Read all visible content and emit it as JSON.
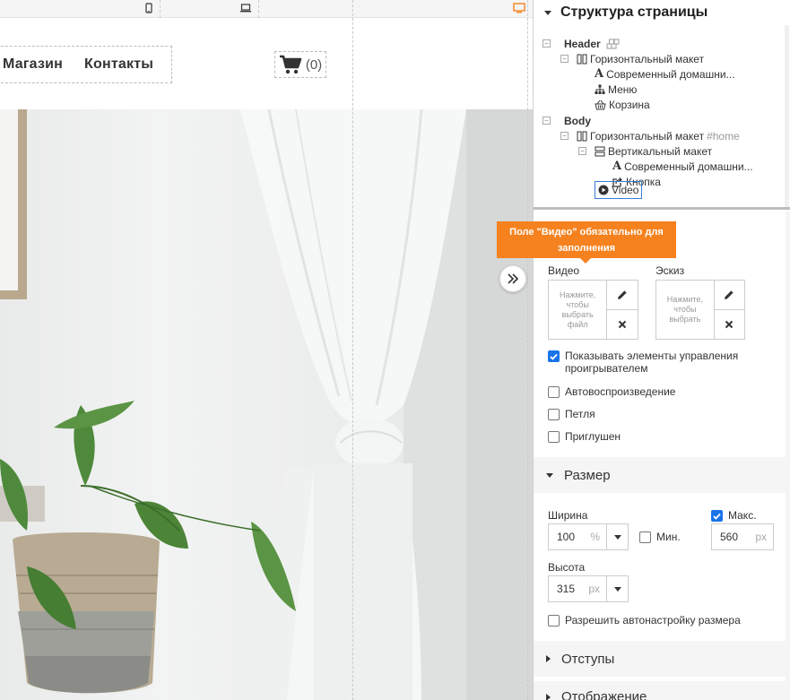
{
  "site": {
    "nav": [
      "Магазин",
      "Контакты"
    ],
    "cart_count": "(0)"
  },
  "tree": {
    "title": "Структура страницы",
    "header_label": "Header",
    "header_layout": "Горизонтальный макет",
    "header_text": "Современный домашни...",
    "header_menu": "Меню",
    "header_cart": "Корзина",
    "body_label": "Body",
    "body_layout": "Горизонтальный макет",
    "body_layout_id": "#home",
    "body_vlayout": "Вертикальный макет",
    "body_text": "Современный домашни...",
    "body_button": "Кнопка",
    "body_video": "Video"
  },
  "tooltip": {
    "line1": "Поле \"Видео\" обязательно для",
    "line2": "заполнения"
  },
  "video_settings": {
    "video_label": "Видео",
    "video_hint": "Нажмите, чтобы выбрать файл",
    "thumb_label": "Эскиз",
    "thumb_hint": "Нажмите, чтобы выбрать",
    "show_controls": "Показывать элементы управления проигрывателем",
    "autoplay": "Автовоспроизведение",
    "loop": "Петля",
    "muted": "Приглушен"
  },
  "size": {
    "section_title": "Размер",
    "width_label": "Ширина",
    "width_value": "100",
    "width_unit": "%",
    "min_label": "Мин.",
    "max_label": "Макс.",
    "max_value": "560",
    "max_unit": "px",
    "height_label": "Высота",
    "height_value": "315",
    "height_unit": "px",
    "auto_size": "Разрешить автонастройку размера"
  },
  "sections": {
    "padding": "Отступы",
    "display": "Отображение"
  },
  "colors": {
    "accent_orange": "#f5821f",
    "checkbox_blue": "#1a73e8",
    "leaf_green": "#4f8a3c"
  }
}
